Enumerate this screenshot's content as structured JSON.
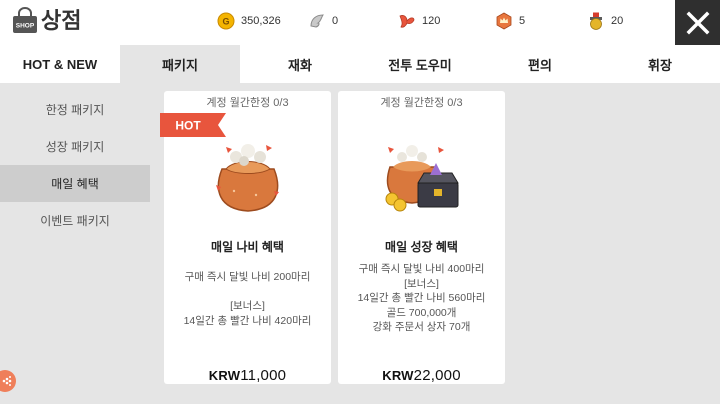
{
  "header": {
    "title": "상점",
    "shop_icon_label": "SHOP",
    "icon": "shop-bag-icon"
  },
  "resources": [
    {
      "icon": "gold-coin-icon",
      "color": "#f4b400",
      "value": "350,326"
    },
    {
      "icon": "silver-wing-icon",
      "color": "#bfbfbf",
      "value": "0"
    },
    {
      "icon": "red-butterfly-icon",
      "color": "#e8553d",
      "value": "120"
    },
    {
      "icon": "crown-token-icon",
      "color": "#e8763d",
      "value": "5"
    },
    {
      "icon": "medal-icon",
      "color": "#e4b52a",
      "value": "20"
    }
  ],
  "tabs": [
    {
      "label": "HOT & NEW"
    },
    {
      "label": "패키지"
    },
    {
      "label": "재화"
    },
    {
      "label": "전투 도우미"
    },
    {
      "label": "편의"
    },
    {
      "label": "휘장"
    }
  ],
  "active_tab": "패키지",
  "sidebar": {
    "items": [
      {
        "label": "한정 패키지"
      },
      {
        "label": "성장 패키지"
      },
      {
        "label": "매일 혜택"
      },
      {
        "label": "이벤트 패키지"
      }
    ],
    "active": "매일 혜택"
  },
  "cards": [
    {
      "limit": "계정 월간한정 0/3",
      "badge": "HOT",
      "name": "매일 나비 혜택",
      "desc": "구매 즉시 달빛 나비 200마리\n\n[보너스]\n14일간 총 빨간 나비 420마리",
      "currency": "KRW",
      "amount": "11,000"
    },
    {
      "limit": "계정 월간한정 0/3",
      "name": "매일 성장 혜택",
      "desc": "구매 즉시 달빛 나비 400마리\n[보너스]\n14일간 총 빨간 나비 560마리\n골드 700,000개\n강화 주문서 상자 70개",
      "currency": "KRW",
      "amount": "22,000"
    }
  ],
  "colors": {
    "accent_tab_bg": "#e5e5e5",
    "sidebar_active_bg": "#cdcdcd",
    "hot_badge": "#e8553d",
    "close_button_bg": "#2f2f2f"
  }
}
